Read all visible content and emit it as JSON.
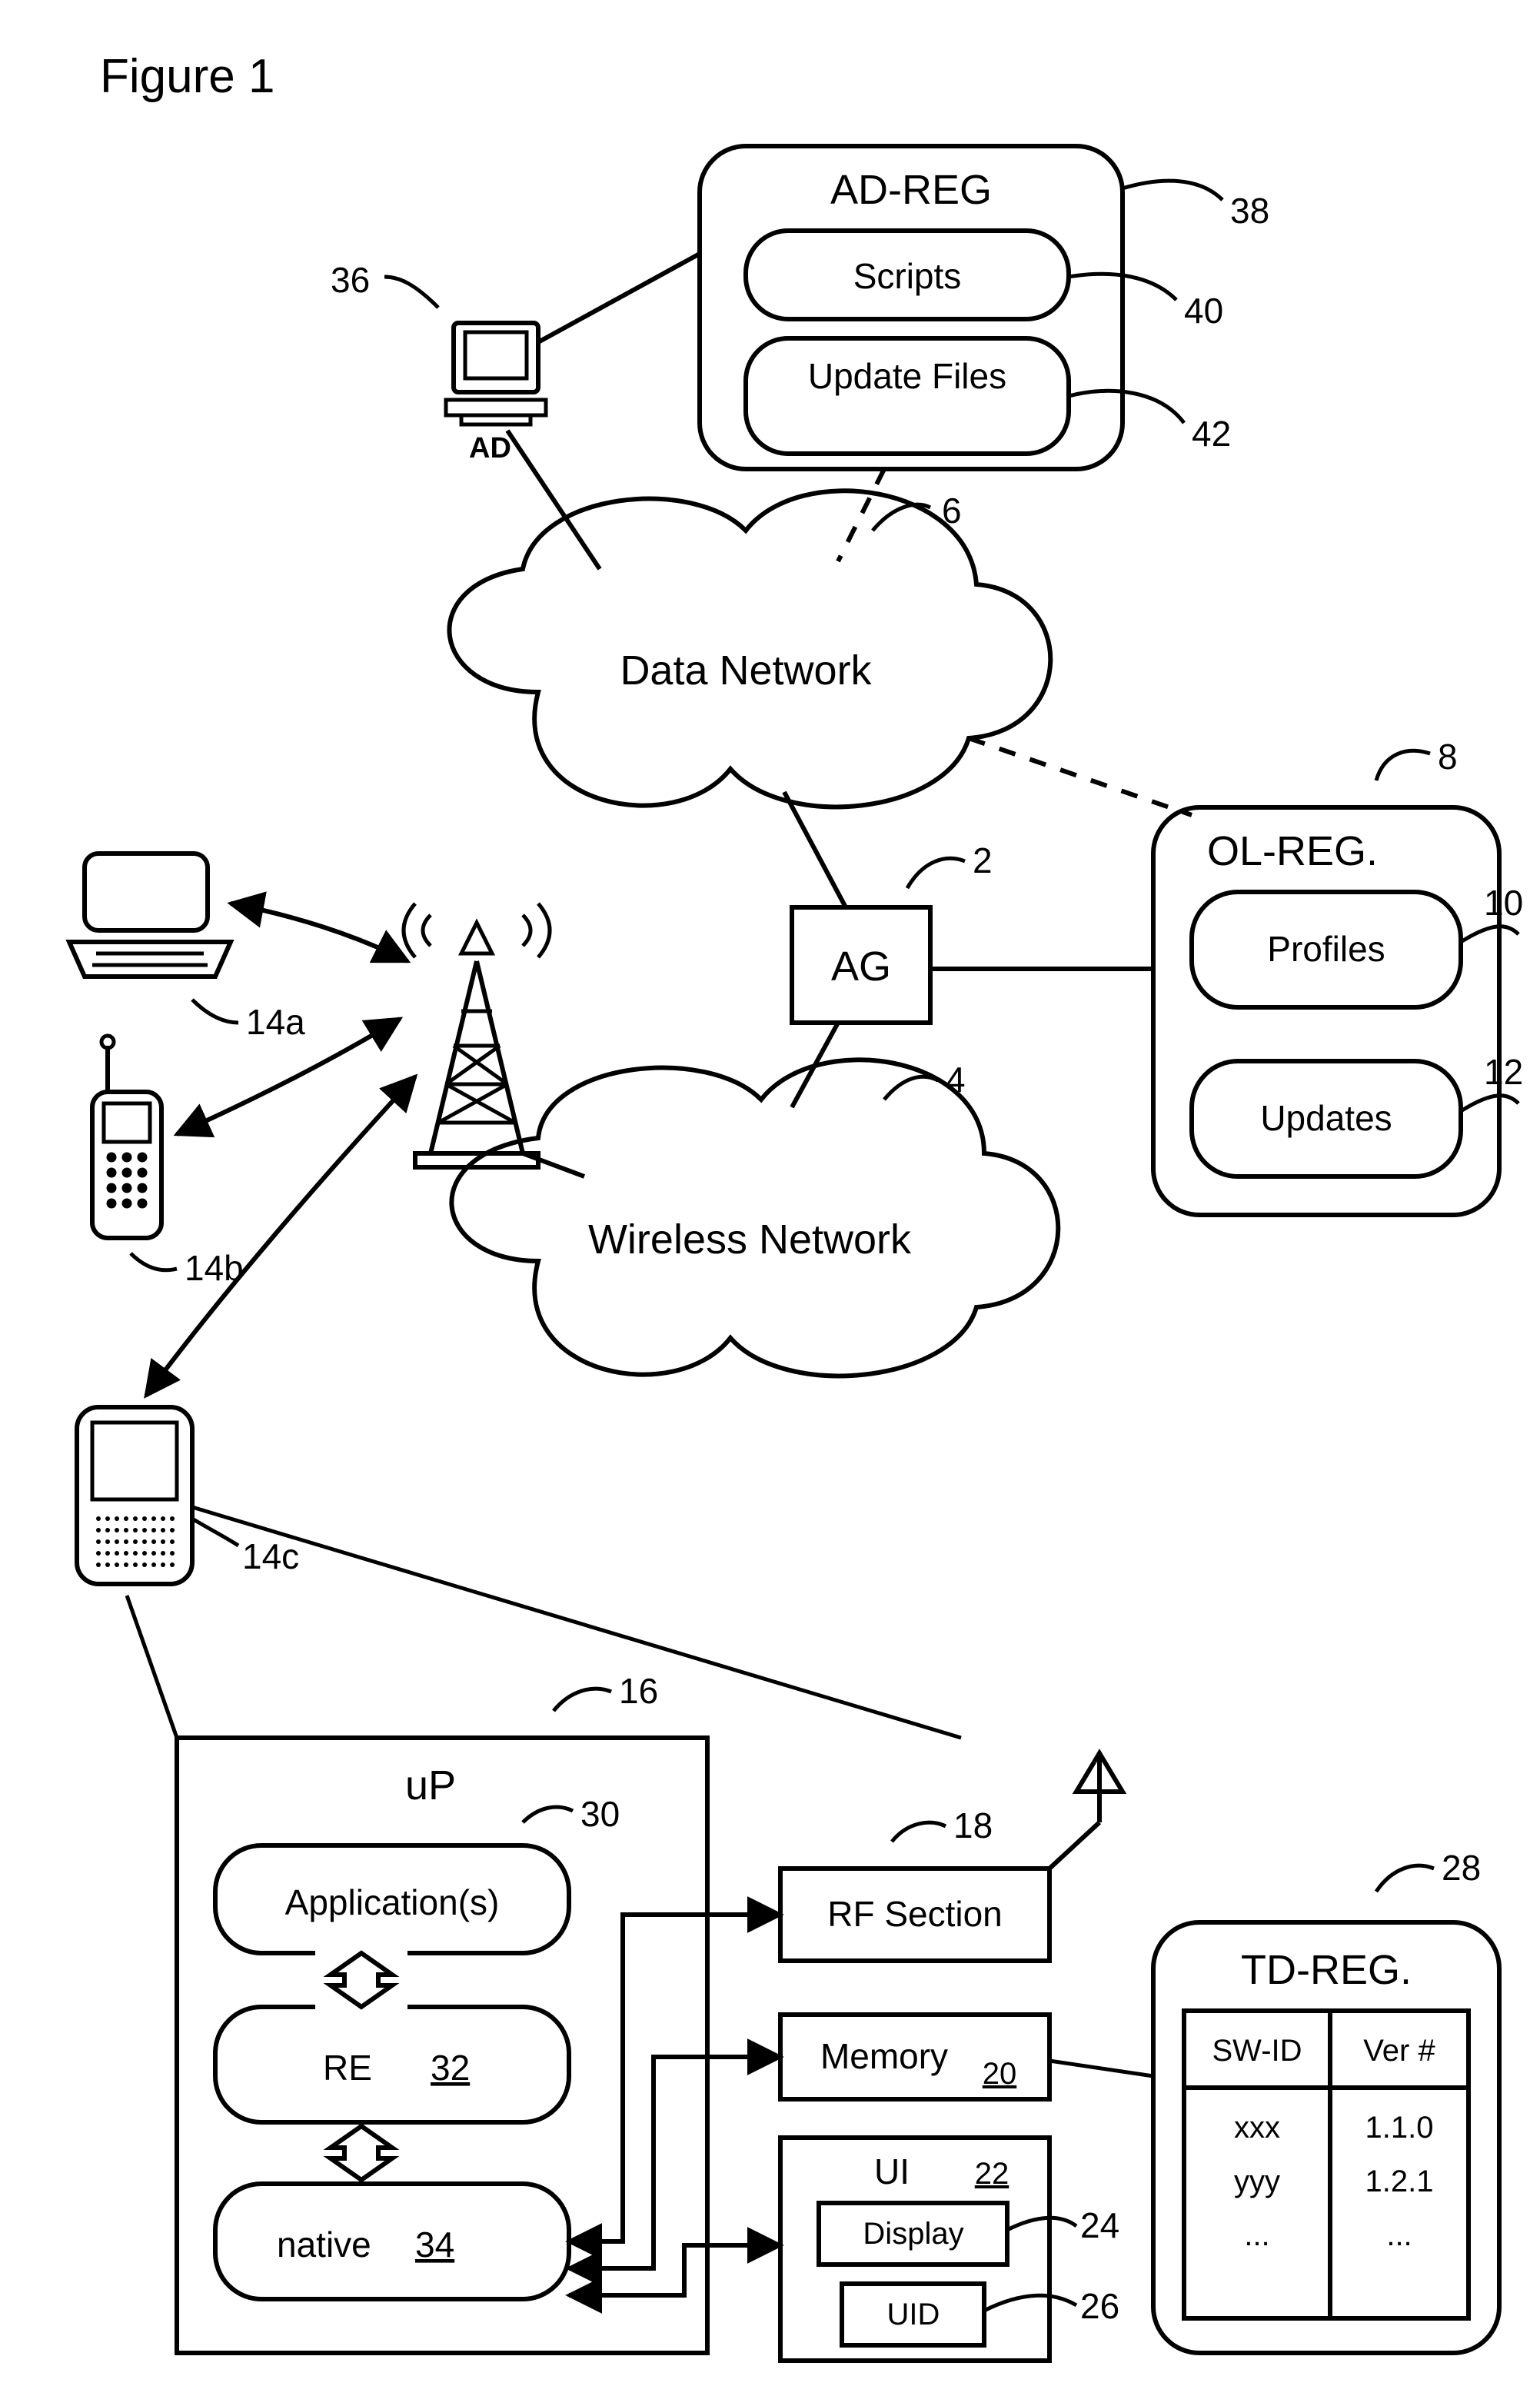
{
  "figure_label": "Figure 1",
  "adreg": {
    "title": "AD-REG",
    "scripts": "Scripts",
    "update_files": "Update Files",
    "ref": "38",
    "ref_scripts": "40",
    "ref_update": "42"
  },
  "ad_pc": {
    "label": "AD",
    "ref": "36"
  },
  "data_network": {
    "label": "Data Network",
    "ref": "6"
  },
  "olreg": {
    "title": "OL-REG.",
    "profiles": "Profiles",
    "updates": "Updates",
    "ref": "8",
    "ref_profiles": "10",
    "ref_updates": "12"
  },
  "ag": {
    "label": "AG",
    "ref": "2"
  },
  "wireless": {
    "label": "Wireless Network",
    "ref": "4"
  },
  "devices": {
    "laptop_ref": "14a",
    "phone_ref": "14b",
    "pda_ref": "14c"
  },
  "up": {
    "title": "uP",
    "ref": "16",
    "apps": "Application(s)",
    "apps_ref": "30",
    "re": "RE",
    "re_num": "32",
    "native": "native",
    "native_num": "34"
  },
  "rf": {
    "label": "RF Section",
    "ref": "18"
  },
  "mem": {
    "label": "Memory",
    "ref": "20"
  },
  "ui": {
    "title": "UI",
    "ref": "22",
    "display": "Display",
    "display_ref": "24",
    "uid": "UID",
    "uid_ref": "26"
  },
  "tdreg": {
    "title": "TD-REG.",
    "ref": "28",
    "col1": "SW-ID",
    "col2": "Ver #",
    "rows": [
      {
        "sw": "xxx",
        "ver": "1.1.0"
      },
      {
        "sw": "yyy",
        "ver": "1.2.1"
      },
      {
        "sw": "...",
        "ver": "..."
      }
    ]
  }
}
